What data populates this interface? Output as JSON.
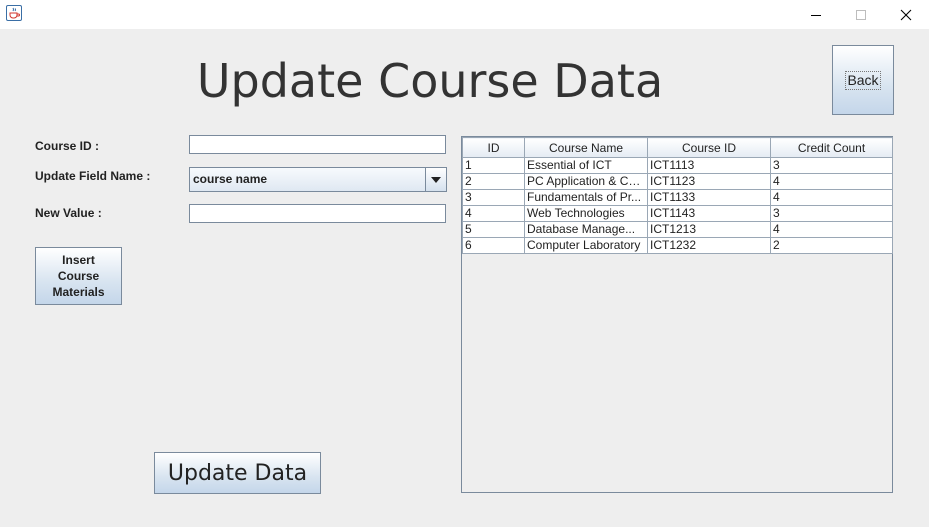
{
  "window": {
    "app_icon": "java-cup-icon",
    "minimize_icon": "minimize-icon",
    "maximize_icon": "maximize-icon",
    "close_icon": "close-icon"
  },
  "header": {
    "title": "Update Course Data",
    "back_label": "Back"
  },
  "form": {
    "course_id_label": "Course ID :",
    "course_id_value": "",
    "update_field_label": "Update Field Name :",
    "update_field_value": "course name",
    "new_value_label": "New Value :",
    "new_value_value": "",
    "insert_materials_label": "Insert\nCourse\nMaterials",
    "update_button_label": "Update Data"
  },
  "table": {
    "columns": [
      "ID",
      "Course Name",
      "Course ID",
      "Credit Count"
    ],
    "rows": [
      [
        "1",
        "Essential of ICT",
        "ICT1113",
        "3"
      ],
      [
        "2",
        "PC Application & Co...",
        "ICT1123",
        "4"
      ],
      [
        "3",
        "Fundamentals of Pr...",
        "ICT1133",
        "4"
      ],
      [
        "4",
        "Web Technologies",
        "ICT1143",
        "3"
      ],
      [
        "5",
        "Database Manage...",
        "ICT1213",
        "4"
      ],
      [
        "6",
        "Computer Laboratory",
        "ICT1232",
        "2"
      ]
    ]
  }
}
